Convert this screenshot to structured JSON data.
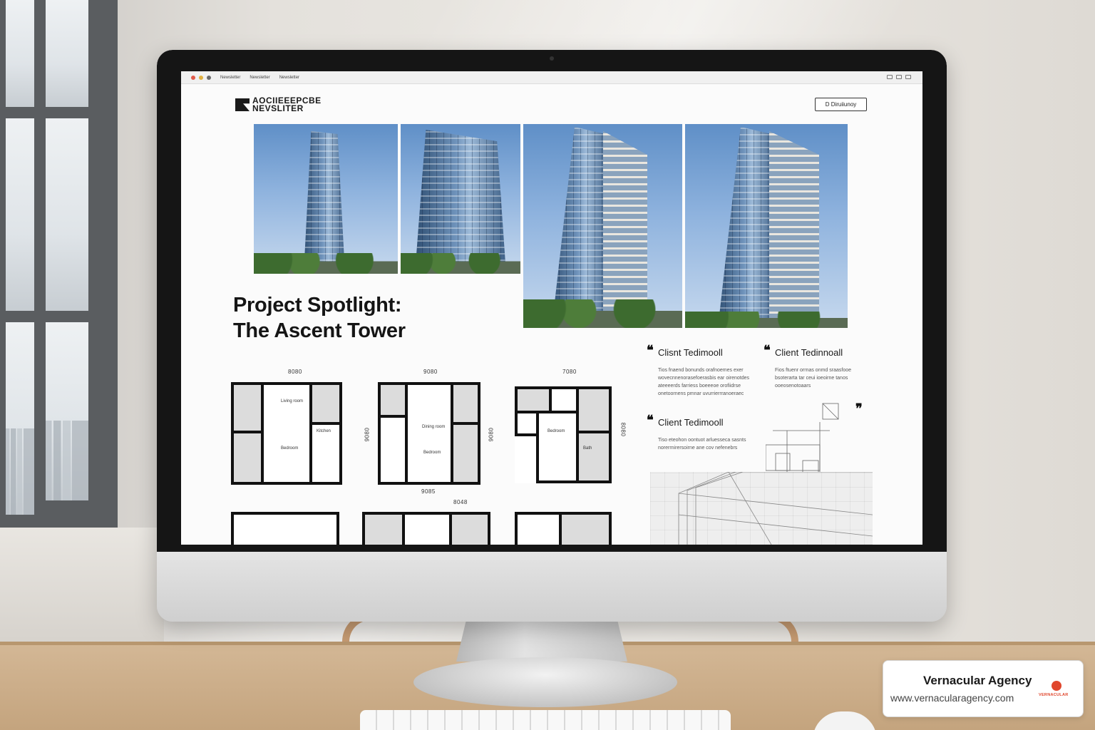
{
  "browser": {
    "tabs": [
      "Newsletter",
      "Newsletter",
      "Newsletter"
    ]
  },
  "newsletter": {
    "logo_line1": "AOCIIEEEPCBE",
    "logo_line2": "NEVSLITER",
    "header_button": "D Diruiiunoy",
    "spotlight_title_line1": "Project Spotlight:",
    "spotlight_title_line2": "The Ascent Tower",
    "floor_plans": [
      {
        "top_dim": "8080",
        "side_dim": "",
        "bottom_dim": ""
      },
      {
        "top_dim": "9080",
        "side_dim": "9080",
        "bottom_dim": "9085"
      },
      {
        "top_dim": "7080",
        "side_dim": "8080",
        "bottom_dim": ""
      }
    ],
    "plan_labels": [
      "Living room",
      "Bedroom",
      "Kitchen",
      "Bath",
      "Dining room",
      "Bedroom"
    ],
    "bottom_plan_dims": [
      "8048"
    ],
    "testimonials": [
      {
        "title": "Clisnt Tedimooll",
        "body": "Tios fnaend bonunds orafnoemes exer wovecnnenorasefoerasbis ear oirenotdes ateeeerds farriess boeeeoe orofiidrse onetoornens pmnar uvurrierrranoeraec"
      },
      {
        "title": "Client Tedinnoall",
        "body": "Fios ftuenr orrnas onmd sraasfooe bsoterarta tar ceui ioeoirne tanos ooeosenotoaars"
      },
      {
        "title": "Client Tedimooll",
        "body": "Tiso eteohon oontuot arluesseca sasnts norerrnirersoirne ane cov nefenebrs"
      }
    ]
  },
  "badge": {
    "name": "Vernacular Agency",
    "url": "www.vernacularagency.com",
    "logo_text": "VERNACULAR"
  },
  "colors": {
    "accent": "#e0462c",
    "screen_bg": "#fbfbfb",
    "text_dark": "#151515"
  }
}
